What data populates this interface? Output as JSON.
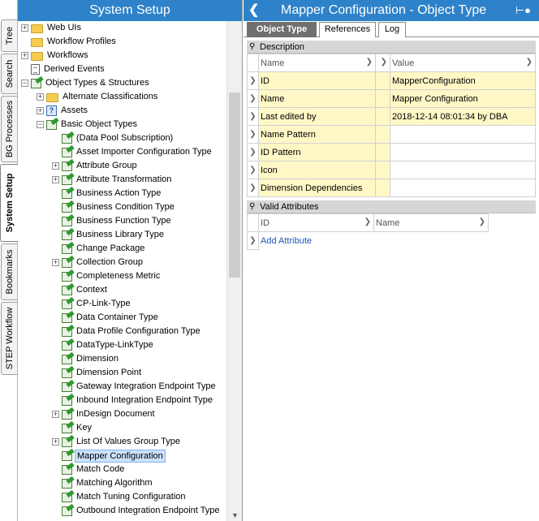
{
  "side_tabs": [
    "Tree",
    "Search",
    "BG Processes",
    "System Setup",
    "Bookmarks",
    "STEP Workflow"
  ],
  "left_panel": {
    "title": "System Setup",
    "tree": [
      {
        "label": "Web UIs",
        "depth": 0,
        "expander": "+",
        "icon": "globe-folder-icon"
      },
      {
        "label": "Workflow Profiles",
        "depth": 0,
        "expander": "",
        "icon": "folder-icon"
      },
      {
        "label": "Workflows",
        "depth": 0,
        "expander": "+",
        "icon": "folder-icon"
      },
      {
        "label": "Derived Events",
        "depth": 0,
        "expander": "",
        "icon": "document-icon"
      },
      {
        "label": "Object Types & Structures",
        "depth": 0,
        "expander": "-",
        "icon": "object-type-icon"
      },
      {
        "label": "Alternate Classifications",
        "depth": 1,
        "expander": "+",
        "icon": "folder-icon"
      },
      {
        "label": "Assets",
        "depth": 1,
        "expander": "+",
        "icon": "asset-icon"
      },
      {
        "label": "Basic Object Types",
        "depth": 1,
        "expander": "-",
        "icon": "object-type-icon"
      },
      {
        "label": "(Data Pool Subscription)",
        "depth": 2,
        "expander": "",
        "icon": "object-type-icon"
      },
      {
        "label": "Asset Importer Configuration Type",
        "depth": 2,
        "expander": "",
        "icon": "object-type-icon"
      },
      {
        "label": "Attribute Group",
        "depth": 2,
        "expander": "+",
        "icon": "object-type-icon"
      },
      {
        "label": "Attribute Transformation",
        "depth": 2,
        "expander": "+",
        "icon": "object-type-icon"
      },
      {
        "label": "Business Action Type",
        "depth": 2,
        "expander": "",
        "icon": "object-type-icon"
      },
      {
        "label": "Business Condition Type",
        "depth": 2,
        "expander": "",
        "icon": "object-type-icon"
      },
      {
        "label": "Business Function Type",
        "depth": 2,
        "expander": "",
        "icon": "object-type-icon"
      },
      {
        "label": "Business Library Type",
        "depth": 2,
        "expander": "",
        "icon": "object-type-icon"
      },
      {
        "label": "Change Package",
        "depth": 2,
        "expander": "",
        "icon": "object-type-icon"
      },
      {
        "label": "Collection Group",
        "depth": 2,
        "expander": "+",
        "icon": "object-type-icon"
      },
      {
        "label": "Completeness Metric",
        "depth": 2,
        "expander": "",
        "icon": "object-type-icon"
      },
      {
        "label": "Context",
        "depth": 2,
        "expander": "",
        "icon": "object-type-icon"
      },
      {
        "label": "CP-Link-Type",
        "depth": 2,
        "expander": "",
        "icon": "object-type-icon"
      },
      {
        "label": "Data Container Type",
        "depth": 2,
        "expander": "",
        "icon": "object-type-icon"
      },
      {
        "label": "Data Profile Configuration Type",
        "depth": 2,
        "expander": "",
        "icon": "object-type-icon"
      },
      {
        "label": "DataType-LinkType",
        "depth": 2,
        "expander": "",
        "icon": "object-type-icon"
      },
      {
        "label": "Dimension",
        "depth": 2,
        "expander": "",
        "icon": "object-type-icon"
      },
      {
        "label": "Dimension Point",
        "depth": 2,
        "expander": "",
        "icon": "object-type-icon"
      },
      {
        "label": "Gateway Integration Endpoint Type",
        "depth": 2,
        "expander": "",
        "icon": "object-type-icon"
      },
      {
        "label": "Inbound Integration Endpoint Type",
        "depth": 2,
        "expander": "",
        "icon": "object-type-icon"
      },
      {
        "label": "InDesign Document",
        "depth": 2,
        "expander": "+",
        "icon": "object-type-icon"
      },
      {
        "label": "Key",
        "depth": 2,
        "expander": "",
        "icon": "object-type-icon"
      },
      {
        "label": "List Of Values Group Type",
        "depth": 2,
        "expander": "+",
        "icon": "object-type-icon"
      },
      {
        "label": "Mapper Configuration",
        "depth": 2,
        "expander": "",
        "icon": "object-type-icon",
        "selected": true
      },
      {
        "label": "Match Code",
        "depth": 2,
        "expander": "",
        "icon": "object-type-icon"
      },
      {
        "label": "Matching Algorithm",
        "depth": 2,
        "expander": "",
        "icon": "object-type-icon"
      },
      {
        "label": "Match Tuning Configuration",
        "depth": 2,
        "expander": "",
        "icon": "object-type-icon"
      },
      {
        "label": "Outbound Integration Endpoint Type",
        "depth": 2,
        "expander": "",
        "icon": "object-type-icon"
      }
    ]
  },
  "right_panel": {
    "title": "Mapper Configuration - Object Type",
    "tabs": [
      "Object Type",
      "References",
      "Log"
    ],
    "description": {
      "heading": "Description",
      "col_name": "Name",
      "col_value": "Value",
      "rows": [
        {
          "name": "ID",
          "value": "MapperConfiguration"
        },
        {
          "name": "Name",
          "value": "Mapper Configuration"
        },
        {
          "name": "Last edited by",
          "value": "2018-12-14 08:01:34 by DBA"
        },
        {
          "name": "Name Pattern",
          "value": ""
        },
        {
          "name": "ID Pattern",
          "value": ""
        },
        {
          "name": "Icon",
          "value": ""
        },
        {
          "name": "Dimension Dependencies",
          "value": ""
        }
      ]
    },
    "valid_attributes": {
      "heading": "Valid Attributes",
      "col_id": "ID",
      "col_name": "Name",
      "add_label": "Add Attribute"
    }
  }
}
